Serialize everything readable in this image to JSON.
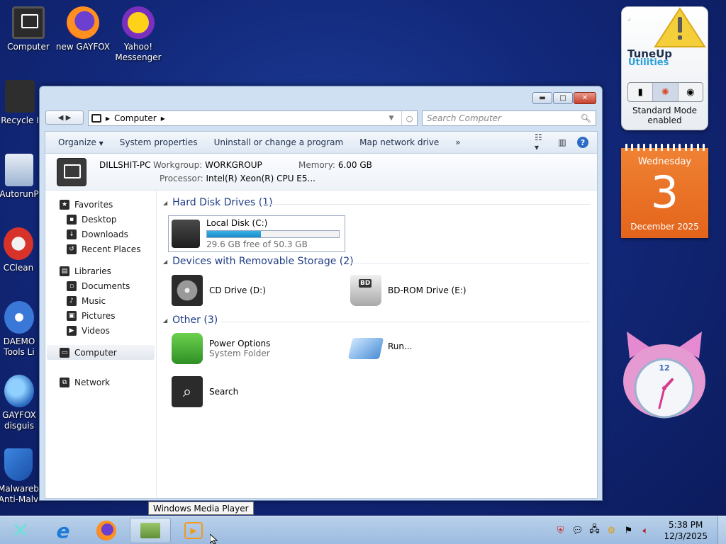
{
  "desktop": {
    "icons": [
      {
        "label": "Computer"
      },
      {
        "label": "new GAYFOX"
      },
      {
        "label": "Yahoo! Messenger"
      },
      {
        "label": "Recycle I"
      },
      {
        "label": "AutorunP"
      },
      {
        "label": "CClean"
      },
      {
        "label": "DAEMO Tools Li"
      },
      {
        "label": "GAYFOX disguis"
      },
      {
        "label": "Malwareb Anti-Malv"
      }
    ]
  },
  "window": {
    "address": {
      "crumb": "Computer",
      "arrow": "▸"
    },
    "search_placeholder": "Search Computer",
    "toolbar": {
      "organize": "Organize",
      "system_properties": "System properties",
      "uninstall": "Uninstall or change a program",
      "map_drive": "Map network drive",
      "more": "»"
    },
    "details": {
      "pc_name": "DILLSHIT-PC",
      "workgroup_label": "Workgroup:",
      "workgroup_value": "WORKGROUP",
      "memory_label": "Memory:",
      "memory_value": "6.00 GB",
      "processor_label": "Processor:",
      "processor_value": "Intel(R) Xeon(R) CPU E5..."
    },
    "nav": {
      "favorites": "Favorites",
      "desktop": "Desktop",
      "downloads": "Downloads",
      "recent_places": "Recent Places",
      "libraries": "Libraries",
      "documents": "Documents",
      "music": "Music",
      "pictures": "Pictures",
      "videos": "Videos",
      "computer": "Computer",
      "network": "Network"
    },
    "groups": {
      "hdd": "Hard Disk Drives (1)",
      "removable": "Devices with Removable Storage (2)",
      "other": "Other (3)"
    },
    "items": {
      "local_disk": {
        "name": "Local Disk (C:)",
        "free": "29.6 GB free of 50.3 GB",
        "used_fraction": 0.41
      },
      "cd_drive": "CD Drive (D:)",
      "bd_drive": "BD-ROM Drive (E:)",
      "bd_badge": "BD",
      "power_options": "Power Options",
      "power_sub": "System Folder",
      "run": "Run...",
      "search": "Search"
    }
  },
  "gadgets": {
    "tuneup": {
      "line1": "TuneUp",
      "line2": "Utilities",
      "mode": "Standard Mode enabled"
    },
    "calendar": {
      "weekday": "Wednesday",
      "day": "3",
      "month": "December 2025"
    },
    "clock_number": "12"
  },
  "tooltip": "Windows Media Player",
  "taskbar": {
    "time": "5:38 PM",
    "date": "12/3/2025"
  }
}
